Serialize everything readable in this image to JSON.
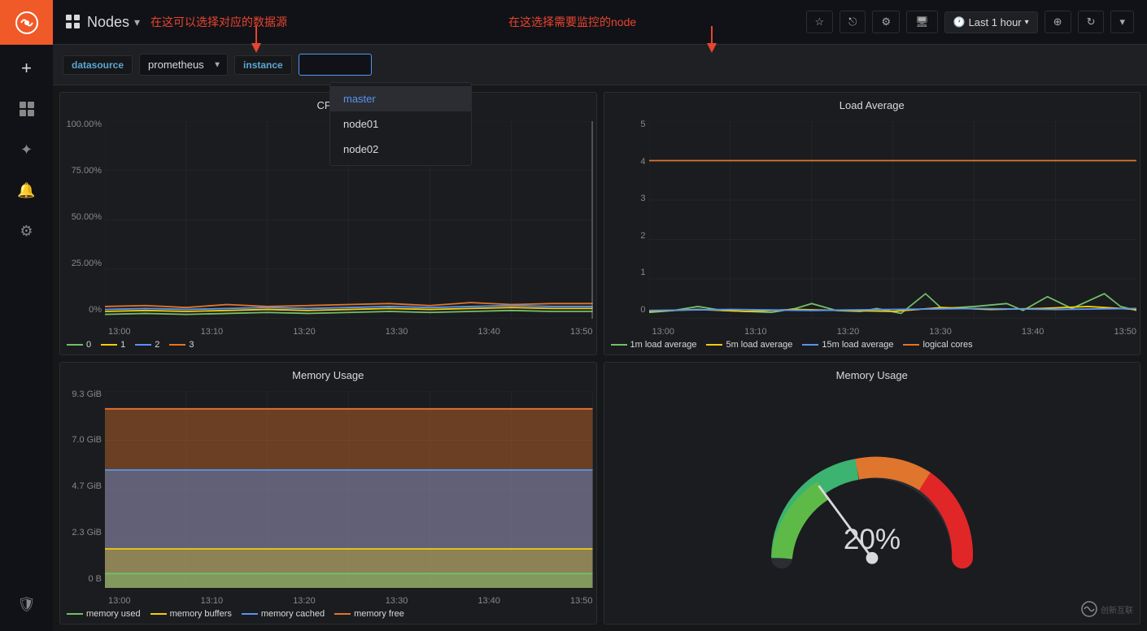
{
  "sidebar": {
    "logo_color": "#f05a28",
    "items": [
      {
        "name": "plus-icon",
        "icon": "+",
        "label": "Add panel"
      },
      {
        "name": "dashboard-icon",
        "icon": "⊞",
        "label": "Dashboard"
      },
      {
        "name": "compass-icon",
        "icon": "✦",
        "label": "Explore"
      },
      {
        "name": "bell-icon",
        "icon": "🔔",
        "label": "Alerting"
      },
      {
        "name": "gear-icon",
        "icon": "⚙",
        "label": "Configuration"
      },
      {
        "name": "shield-icon",
        "icon": "🛡",
        "label": "Server Admin"
      }
    ]
  },
  "header": {
    "title": "Nodes",
    "dropdown_icon": "▾",
    "buttons": [
      {
        "name": "star-button",
        "icon": "☆"
      },
      {
        "name": "share-button",
        "icon": "⎋"
      },
      {
        "name": "settings-button",
        "icon": "⚙"
      },
      {
        "name": "tv-button",
        "icon": "🖥"
      }
    ],
    "time_range": "Last 1 hour",
    "zoom_icon": "⊕",
    "refresh_icon": "↻",
    "more_icon": "▾"
  },
  "toolbar": {
    "datasource_label": "datasource",
    "datasource_value": "prometheus",
    "instance_label": "instance",
    "instance_placeholder": "",
    "annotation1": "在这可以选择对应的数据源",
    "annotation2": "在这选择需要监控的node"
  },
  "dropdown": {
    "items": [
      {
        "label": "master",
        "active": true
      },
      {
        "label": "node01",
        "active": false
      },
      {
        "label": "node02",
        "active": false
      }
    ]
  },
  "charts": {
    "cpu_title": "CPU",
    "load_title": "Load Average",
    "mem_title": "Memory Usage",
    "mem_gauge_title": "Memory Usage",
    "mem_gauge_value": "20%",
    "cpu_legend": [
      {
        "color": "#73bf69",
        "label": "0"
      },
      {
        "color": "#f2cc0c",
        "label": "1"
      },
      {
        "color": "#5794f2",
        "label": "2"
      },
      {
        "color": "#e0752d",
        "label": "3"
      }
    ],
    "load_legend": [
      {
        "color": "#73bf69",
        "label": "1m load average"
      },
      {
        "color": "#f2cc0c",
        "label": "5m load average"
      },
      {
        "color": "#5794f2",
        "label": "15m load average"
      },
      {
        "color": "#e0752d",
        "label": "logical cores"
      }
    ],
    "mem_legend": [
      {
        "color": "#73bf69",
        "label": "memory used"
      },
      {
        "color": "#f2cc0c",
        "label": "memory buffers"
      },
      {
        "color": "#5794f2",
        "label": "memory cached"
      },
      {
        "color": "#e0752d",
        "label": "memory free"
      }
    ],
    "x_labels": [
      "13:00",
      "13:10",
      "13:20",
      "13:30",
      "13:40",
      "13:50"
    ],
    "cpu_y_labels": [
      "100.00%",
      "75.00%",
      "50.00%",
      "25.00%",
      "0%"
    ],
    "load_y_labels": [
      "5",
      "4",
      "3",
      "2",
      "1",
      "0"
    ],
    "mem_y_labels": [
      "9.3 GiB",
      "7.0 GiB",
      "4.7 GiB",
      "2.3 GiB",
      "0 B"
    ]
  }
}
